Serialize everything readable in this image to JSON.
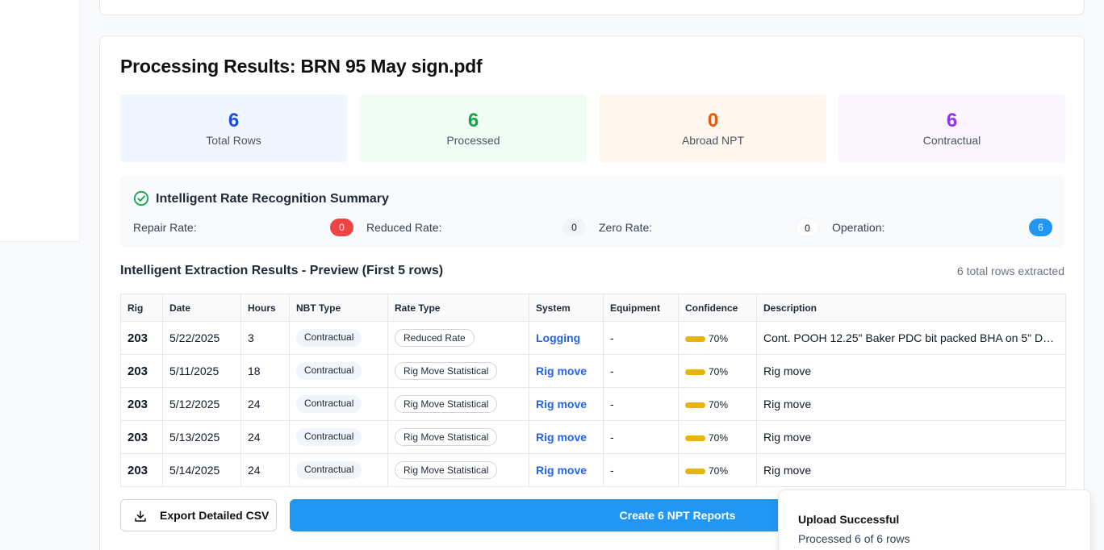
{
  "page": {
    "title": "Processing Results: BRN 95 May sign.pdf"
  },
  "stats": [
    {
      "value": "6",
      "label": "Total Rows",
      "color": "#1d4ed8",
      "bg": "#eff6ff"
    },
    {
      "value": "6",
      "label": "Processed",
      "color": "#16a34a",
      "bg": "#f0fdf4"
    },
    {
      "value": "0",
      "label": "Abroad NPT",
      "color": "#ea580c",
      "bg": "#fff7ed"
    },
    {
      "value": "6",
      "label": "Contractual",
      "color": "#9333ea",
      "bg": "#faf5ff"
    }
  ],
  "summary": {
    "title": "Intelligent Rate Recognition Summary",
    "rates": [
      {
        "label": "Repair Rate:",
        "value": "0",
        "bg": "#ef4444",
        "fg": "#ffffff"
      },
      {
        "label": "Reduced Rate:",
        "value": "0",
        "bg": "#f1f5f9",
        "fg": "#111827"
      },
      {
        "label": "Zero Rate:",
        "value": "0",
        "bg": "#ffffff",
        "fg": "#111827"
      },
      {
        "label": "Operation:",
        "value": "6",
        "bg": "#2196f3",
        "fg": "#ffffff"
      }
    ]
  },
  "extraction": {
    "title": "Intelligent Extraction Results - Preview (First 5 rows)",
    "count_text": "6 total rows extracted",
    "columns": [
      "Rig",
      "Date",
      "Hours",
      "NBT Type",
      "Rate Type",
      "System",
      "Equipment",
      "Confidence",
      "Description"
    ],
    "rows": [
      {
        "rig": "203",
        "date": "5/22/2025",
        "hours": "3",
        "nbt": "Contractual",
        "rate": "Reduced Rate",
        "system": "Logging",
        "equipment": "-",
        "confidence": "70%",
        "description": "Cont. POOH 12.25\" Baker PDC bit packed BHA on 5\" DP s..."
      },
      {
        "rig": "203",
        "date": "5/11/2025",
        "hours": "18",
        "nbt": "Contractual",
        "rate": "Rig Move Statistical",
        "system": "Rig move",
        "equipment": "-",
        "confidence": "70%",
        "description": "Rig move"
      },
      {
        "rig": "203",
        "date": "5/12/2025",
        "hours": "24",
        "nbt": "Contractual",
        "rate": "Rig Move Statistical",
        "system": "Rig move",
        "equipment": "-",
        "confidence": "70%",
        "description": "Rig move"
      },
      {
        "rig": "203",
        "date": "5/13/2025",
        "hours": "24",
        "nbt": "Contractual",
        "rate": "Rig Move Statistical",
        "system": "Rig move",
        "equipment": "-",
        "confidence": "70%",
        "description": "Rig move"
      },
      {
        "rig": "203",
        "date": "5/14/2025",
        "hours": "24",
        "nbt": "Contractual",
        "rate": "Rig Move Statistical",
        "system": "Rig move",
        "equipment": "-",
        "confidence": "70%",
        "description": "Rig move"
      }
    ]
  },
  "actions": {
    "export_label": "Export Detailed CSV",
    "export_icon": "download-icon",
    "create_label": "Create 6 NPT Reports"
  },
  "toast": {
    "title": "Upload Successful",
    "description": "Processed 6 of 6 rows"
  },
  "colors": {
    "accent": "#2196f3",
    "link": "#2563eb",
    "confidence_bar": "#eab308",
    "success_check": "#16a34a"
  }
}
